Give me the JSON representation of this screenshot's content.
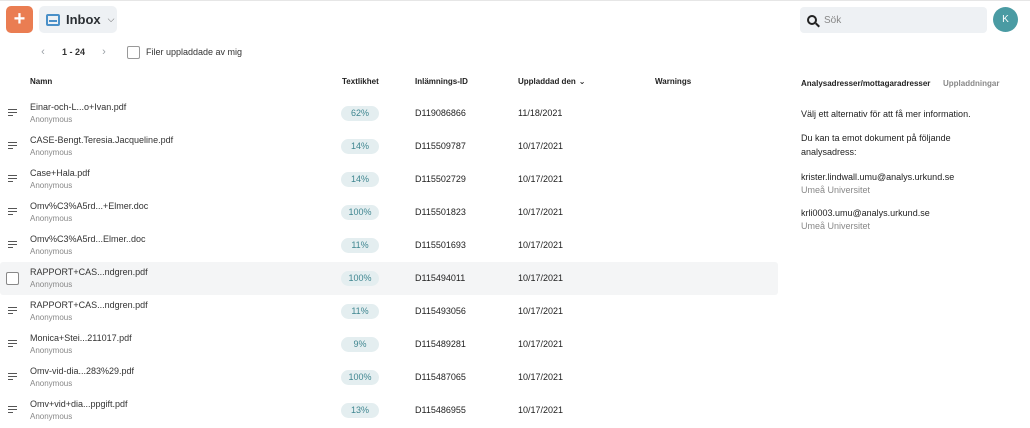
{
  "header": {
    "add_label": "+",
    "inbox_label": "Inbox",
    "search_placeholder": "Sök",
    "avatar_initial": "K"
  },
  "pager": {
    "prev": "‹",
    "range": "1 - 24",
    "next": "›"
  },
  "filter_label": "Filer uppladdade av mig",
  "columns": {
    "name": "Namn",
    "similarity": "Textlikhet",
    "submission_id": "Inlämnings-ID",
    "uploaded": "Uppladdad den",
    "warnings": "Warnings"
  },
  "rows": [
    {
      "name": "Einar-och-L...o+Ivan.pdf",
      "user": "Anonymous",
      "similarity": "62%",
      "id": "D119086866",
      "date": "11/18/2021"
    },
    {
      "name": "CASE-Bengt.Teresia.Jacqueline.pdf",
      "user": "Anonymous",
      "similarity": "14%",
      "id": "D115509787",
      "date": "10/17/2021"
    },
    {
      "name": "Case+Hala.pdf",
      "user": "Anonymous",
      "similarity": "14%",
      "id": "D115502729",
      "date": "10/17/2021"
    },
    {
      "name": "Omv%C3%A5rd...+Elmer.doc",
      "user": "Anonymous",
      "similarity": "100%",
      "id": "D115501823",
      "date": "10/17/2021"
    },
    {
      "name": "Omv%C3%A5rd...Elmer..doc",
      "user": "Anonymous",
      "similarity": "11%",
      "id": "D115501693",
      "date": "10/17/2021"
    },
    {
      "name": "RAPPORT+CAS...ndgren.pdf",
      "user": "Anonymous",
      "similarity": "100%",
      "id": "D115494011",
      "date": "10/17/2021"
    },
    {
      "name": "RAPPORT+CAS...ndgren.pdf",
      "user": "Anonymous",
      "similarity": "11%",
      "id": "D115493056",
      "date": "10/17/2021"
    },
    {
      "name": "Monica+Stei...211017.pdf",
      "user": "Anonymous",
      "similarity": "9%",
      "id": "D115489281",
      "date": "10/17/2021"
    },
    {
      "name": "Omv-vid-dia...283%29.pdf",
      "user": "Anonymous",
      "similarity": "100%",
      "id": "D115487065",
      "date": "10/17/2021"
    },
    {
      "name": "Omv+vid+dia...ppgift.pdf",
      "user": "Anonymous",
      "similarity": "13%",
      "id": "D115486955",
      "date": "10/17/2021"
    }
  ],
  "right_panel": {
    "tab_addresses": "Analysadresser/mottagaradresser",
    "tab_uploads": "Uppladdningar",
    "hint": "Välj ett alternativ för att få mer information.",
    "intro": "Du kan ta emot dokument på följande analysadress:",
    "addresses": [
      {
        "email": "krister.lindwall.umu@analys.urkund.se",
        "org": "Umeå Universitet"
      },
      {
        "email": "krli0003.umu@analys.urkund.se",
        "org": "Umeå Universitet"
      }
    ]
  }
}
